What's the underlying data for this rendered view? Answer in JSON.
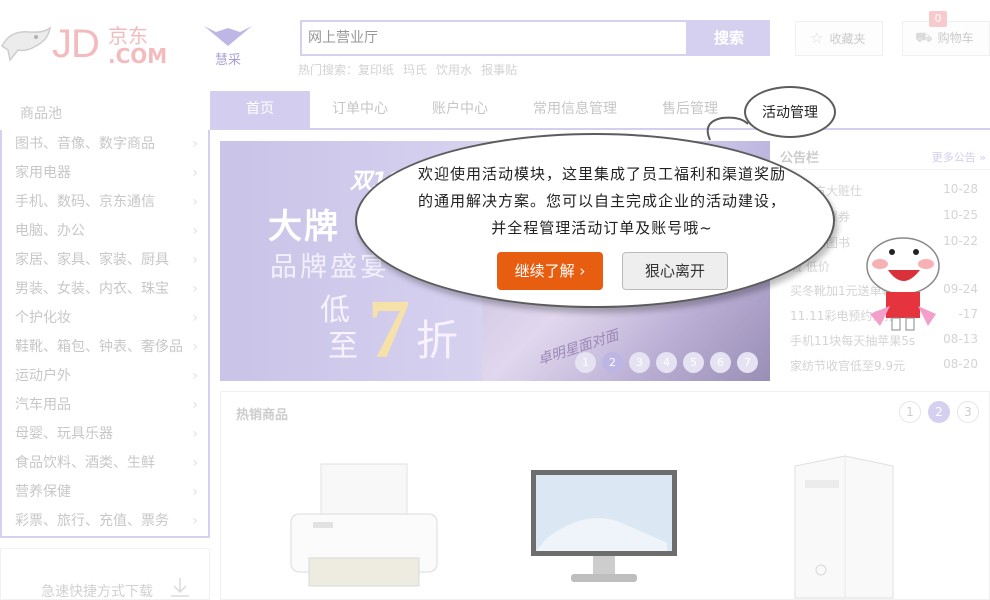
{
  "header": {
    "logo_text": "JD",
    "logo_cn": "京东",
    "logo_com": ".COM",
    "huicai": "慧采",
    "search_placeholder": "网上营业厅",
    "search_button": "搜索",
    "hot_label": "热门搜索：",
    "hot_terms": [
      "复印纸",
      "玛氏",
      "饮用水",
      "报事贴"
    ],
    "favorites": "收藏夹",
    "cart": "购物车",
    "cart_count": "0"
  },
  "nav": {
    "pool_label": "商品池",
    "tabs": [
      "首页",
      "订单中心",
      "账户中心",
      "常用信息管理",
      "售后管理",
      "活动管理"
    ]
  },
  "sidebar": {
    "categories": [
      "图书、音像、数字商品",
      "家用电器",
      "手机、数码、京东通信",
      "电脑、办公",
      "家居、家具、家装、厨具",
      "男装、女装、内衣、珠宝",
      "个护化妆",
      "鞋靴、箱包、钟表、奢侈品",
      "运动户外",
      "汽车用品",
      "母婴、玩具乐器",
      "食品饮料、酒类、生鲜",
      "营养保健",
      "彩票、旅行、充值、票务"
    ],
    "quick_download": "急速快捷方式下载"
  },
  "banner": {
    "line1": "双10",
    "line2": "大牌",
    "line3": "品牌盛宴",
    "di": "低",
    "zhi": "至",
    "seven": "7",
    "zhe": "折",
    "slogan": "卓明星面对面",
    "dots": [
      "1",
      "2",
      "3",
      "4",
      "5",
      "6",
      "7"
    ],
    "active_dot": "2"
  },
  "notice": {
    "title": "公告栏",
    "more": "更多公告 »",
    "items": [
      {
        "text": "疯抢方大赃仕",
        "date": "10-28"
      },
      {
        "text": "超值优惠券",
        "date": "10-25"
      },
      {
        "text": "终幻想图书",
        "date": "10-22"
      },
      {
        "text": "城 低价",
        "date": ""
      },
      {
        "text": "买冬靴加1元送单鞋",
        "date": "09-24"
      },
      {
        "text": "11.11彩电预约疯抢",
        "date": "-17"
      },
      {
        "text": "手机11块每天抽苹果5s",
        "date": "08-13"
      },
      {
        "text": "家纺节收官低至9.9元",
        "date": "08-20"
      }
    ]
  },
  "hot_products": {
    "title": "热销商品",
    "pages": [
      "1",
      "2",
      "3"
    ],
    "active_page": "2"
  },
  "popup": {
    "tab_label": "活动管理",
    "message": "欢迎使用活动模块，这里集成了员工福利和渠道奖励的通用解决方案。您可以自主完成企业的活动建设，并全程管理活动订单及账号哦~",
    "continue_button": "继续了解 ›",
    "leave_button": "狠心离开"
  },
  "colors": {
    "accent": "#c4bdea",
    "cta": "#e85e11",
    "logo": "#f0a4aa"
  }
}
